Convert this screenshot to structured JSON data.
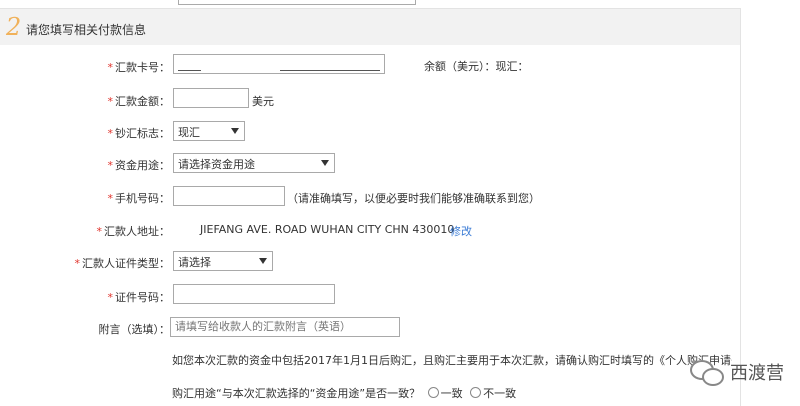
{
  "section": {
    "number": "2",
    "title": "请您填写相关付款信息"
  },
  "fields": {
    "card_no": {
      "label": "汇款卡号：",
      "value": "",
      "balance_label": "余额（美元）：现汇："
    },
    "amount": {
      "label": "汇款金额：",
      "value": "",
      "unit": "美元"
    },
    "currency_flag": {
      "label": "钞汇标志：",
      "selected": "现汇"
    },
    "purpose": {
      "label": "资金用途：",
      "selected": "请选择资金用途"
    },
    "phone": {
      "label": "手机号码：",
      "value": "",
      "hint": "（请准确填写，以便必要时我们能够准确联系到您）"
    },
    "address": {
      "label": "汇款人地址：",
      "value": "JIEFANG AVE. ROAD WUHAN CITY CHN 430010",
      "edit_link": "修改"
    },
    "id_type": {
      "label": "汇款人证件类型：",
      "selected": "请选择"
    },
    "id_no": {
      "label": "证件号码：",
      "value": ""
    },
    "remark": {
      "label": "附言（选填）：",
      "placeholder": "请填写给收款人的汇款附言（英语）"
    }
  },
  "notice": {
    "line1": "如您本次汇款的资金中包括2017年1月1日后购汇，且购汇主要用于本次汇款，请确认购汇时填写的《个人购汇申请书》中",
    "line2": "购汇用途“与本次汇款选择的“资金用途”是否一致？",
    "option_yes": "一致",
    "option_no": "不一致"
  },
  "required_mark": "*",
  "watermark": {
    "text": "西渡营",
    "icon": "wechat-icon"
  }
}
